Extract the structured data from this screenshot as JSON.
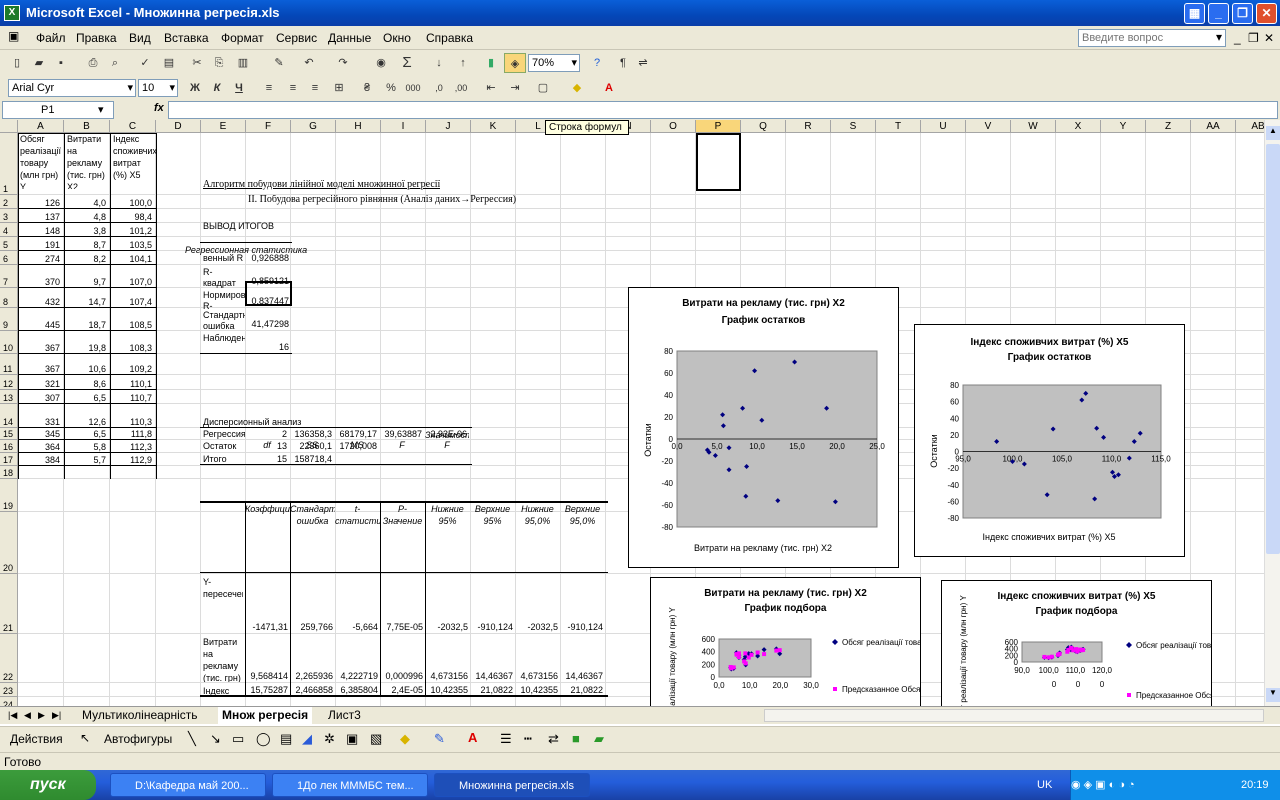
{
  "window": {
    "title": "Microsoft Excel - Множинна регресія.xls"
  },
  "menu": [
    "Файл",
    "Правка",
    "Вид",
    "Вставка",
    "Формат",
    "Сервис",
    "Данные",
    "Окно",
    "Справка"
  ],
  "help_placeholder": "Введите вопрос",
  "toolbar": {
    "zoom": "70%",
    "font": "Arial Cyr",
    "size": "10",
    "bold": "Ж",
    "italic": "К",
    "underline": "Ч",
    "sigma": "Σ"
  },
  "formula_bar": {
    "cell": "P1",
    "fx": "fx",
    "tooltip": "Строка формул"
  },
  "columns": [
    "A",
    "B",
    "C",
    "D",
    "E",
    "F",
    "G",
    "H",
    "I",
    "J",
    "K",
    "L",
    "M",
    "N",
    "O",
    "P",
    "Q",
    "R",
    "S",
    "T",
    "U",
    "V",
    "W",
    "X",
    "Y",
    "Z",
    "AA",
    "AB"
  ],
  "rows": [
    "1",
    "2",
    "3",
    "4",
    "5",
    "6",
    "7",
    "8",
    "9",
    "10",
    "11",
    "12",
    "13",
    "14",
    "15",
    "16",
    "17",
    "18",
    "19",
    "20",
    "21",
    "22",
    "23",
    "24"
  ],
  "headers": {
    "A": "Обсяг реалізації товару (млн грн) Y",
    "B": "Витрати на рекламу (тис. грн) X2",
    "C": "Індекс споживчих витрат (%) X5"
  },
  "data": [
    [
      "126",
      "4,0",
      "100,0"
    ],
    [
      "137",
      "4,8",
      "98,4"
    ],
    [
      "148",
      "3,8",
      "101,2"
    ],
    [
      "191",
      "8,7",
      "103,5"
    ],
    [
      "274",
      "8,2",
      "104,1"
    ],
    [
      "370",
      "9,7",
      "107,0"
    ],
    [
      "432",
      "14,7",
      "107,4"
    ],
    [
      "445",
      "18,7",
      "108,5"
    ],
    [
      "367",
      "19,8",
      "108,3"
    ],
    [
      "367",
      "10,6",
      "109,2"
    ],
    [
      "321",
      "8,6",
      "110,1"
    ],
    [
      "307",
      "6,5",
      "110,7"
    ],
    [
      "331",
      "12,6",
      "110,3"
    ],
    [
      "345",
      "6,5",
      "111,8"
    ],
    [
      "364",
      "5,8",
      "112,3"
    ],
    [
      "384",
      "5,7",
      "112,9"
    ]
  ],
  "algo_title": "Алгоритм побудови лінійної моделі множинної регресії",
  "algo_sub": "ІІ. Побудова регресійного рівняння (Аналіз даних→Регрессия)",
  "output_title": "ВЫВОД ИТОГОВ",
  "regstat_title": "Регрессионная статистика",
  "regstat": [
    [
      "венный R",
      "0,926888"
    ],
    [
      "R-квадрат",
      "0,859121"
    ],
    [
      "Нормированный R-",
      "0,837447"
    ],
    [
      "Стандартная ошибка",
      "41,47298"
    ],
    [
      "Наблюдения",
      "16"
    ]
  ],
  "anova_title": "Дисперсионный анализ",
  "anova_head": [
    "df",
    "SS",
    "MS",
    "F",
    "Значимость F"
  ],
  "anova": [
    [
      "Регрессия",
      "2",
      "136358,3",
      "68179,17",
      "39,63887",
      "2,93E-06"
    ],
    [
      "Остаток",
      "13",
      "22360,1",
      "1720,008",
      "",
      ""
    ],
    [
      "Итого",
      "15",
      "158718,4",
      "",
      "",
      ""
    ]
  ],
  "coef_head": [
    "Коэффициенты",
    "Стандартная ошибка",
    "t-статистика",
    "P-Значение",
    "Нижние 95%",
    "Верхние 95%",
    "Нижние 95,0%",
    "Верхние 95,0%"
  ],
  "coef": [
    [
      "Y-пересечение",
      "-1471,31",
      "259,766",
      "-5,664",
      "7,75E-05",
      "-2032,5",
      "-910,124",
      "-2032,5",
      "-910,124"
    ],
    [
      "Витрати на рекламу (тис. грн) X2",
      "9,568414",
      "2,265936",
      "4,222719",
      "0,000996",
      "4,673156",
      "14,46367",
      "4,673156",
      "14,46367"
    ],
    [
      "Індекс споживчих витрат",
      "15,75287",
      "2,466858",
      "6,385804",
      "2,4E-05",
      "10,42355",
      "21,0822",
      "10,42355",
      "21,0822"
    ]
  ],
  "charts": {
    "r1": {
      "title": "Витрати на рекламу (тис. грн) X2",
      "sub": "График остатков",
      "xlabel": "Витрати на рекламу (тис. грн) X2",
      "ylabel": "Остатки",
      "yticks": [
        "80",
        "60",
        "40",
        "20",
        "0",
        "-20",
        "-40",
        "-60",
        "-80"
      ],
      "xticks": [
        "0,0",
        "5,0",
        "10,0",
        "15,0",
        "20,0",
        "25,0"
      ]
    },
    "r2": {
      "title": "Індекс споживчих витрат (%) X5",
      "sub": "График остатков",
      "xlabel": "Індекс споживчих витрат (%) X5",
      "ylabel": "Остатки",
      "yticks": [
        "80",
        "60",
        "40",
        "20",
        "0",
        "-20",
        "-40",
        "-60",
        "-80"
      ],
      "xticks": [
        "95,0",
        "100,0",
        "105,0",
        "110,0",
        "115,0"
      ]
    },
    "f1": {
      "title": "Витрати на рекламу (тис. грн) X2",
      "sub": "График подбора",
      "ylabel": "Обсяг реалізації товару (млн грн) Y",
      "yticks": [
        "600",
        "400",
        "200",
        "0"
      ],
      "xticks": [
        "0,0",
        "10,0",
        "20,0",
        "30,0"
      ],
      "leg1": "Обсяг реалізації товару (млн грн) Y",
      "leg2": "Предсказанное Обсяг реалізації"
    },
    "f2": {
      "title": "Індекс споживчих витрат (%) X5",
      "sub": "График подбора",
      "ylabel": "Обсяг реалізації товару (млн грн) Y",
      "yticks": [
        "600",
        "400",
        "200",
        "0"
      ],
      "xticks": [
        "90,0",
        "100,0",
        "110,0",
        "120,0"
      ],
      "xticks2": [
        "0",
        "0",
        "0"
      ],
      "leg1": "Обсяг реалізації товару (млн грн) Y",
      "leg2": "Предсказанное Обсяг реалізації"
    }
  },
  "chart_data": [
    {
      "type": "scatter",
      "title": "Витрати на рекламу (тис. грн) X2 График остатков",
      "xlabel": "Витрати на рекламу (тис. грн) X2",
      "ylabel": "Остатки",
      "xlim": [
        0,
        25
      ],
      "ylim": [
        -80,
        80
      ],
      "x": [
        4.0,
        4.8,
        3.8,
        8.7,
        8.2,
        9.7,
        14.7,
        18.7,
        19.8,
        10.6,
        8.6,
        6.5,
        12.6,
        6.5,
        5.8,
        5.7
      ],
      "y": [
        -12,
        -15,
        -10,
        -25,
        28,
        62,
        70,
        28,
        -57,
        17,
        -52,
        -8,
        -56,
        -28,
        12,
        22
      ]
    },
    {
      "type": "scatter",
      "title": "Індекс споживчих витрат (%) X5 График остатков",
      "xlabel": "Індекс споживчих витрат (%) X5",
      "ylabel": "Остатки",
      "xlim": [
        95,
        115
      ],
      "ylim": [
        -80,
        80
      ],
      "x": [
        100.0,
        98.4,
        101.2,
        103.5,
        104.1,
        107.0,
        107.4,
        108.5,
        108.3,
        109.2,
        110.1,
        110.7,
        110.3,
        111.8,
        112.3,
        112.9
      ],
      "y": [
        -12,
        12,
        -15,
        -52,
        27,
        62,
        70,
        28,
        -57,
        17,
        -25,
        -28,
        -30,
        -8,
        12,
        22
      ]
    },
    {
      "type": "scatter",
      "title": "Витрати на рекламу (тис. грн) X2 График подбора",
      "xlim": [
        0,
        30
      ],
      "ylim": [
        0,
        600
      ],
      "series": [
        {
          "name": "Обсяг реалізації товару (млн грн) Y",
          "x": [
            4.0,
            4.8,
            3.8,
            8.7,
            8.2,
            9.7,
            14.7,
            18.7,
            19.8,
            10.6,
            8.6,
            6.5,
            12.6,
            6.5,
            5.8,
            5.7
          ],
          "y": [
            126,
            137,
            148,
            191,
            274,
            370,
            432,
            445,
            367,
            367,
            321,
            307,
            331,
            345,
            364,
            384
          ]
        },
        {
          "name": "Предсказанное Обсяг реалізації",
          "x": [
            4.0,
            4.8,
            3.8,
            8.7,
            8.2,
            9.7,
            14.7,
            18.7,
            19.8,
            10.6,
            8.6,
            6.5,
            12.6,
            6.5,
            5.8,
            5.7
          ],
          "y": [
            138,
            152,
            158,
            216,
            246,
            308,
            362,
            417,
            424,
            350,
            373,
            315,
            387,
            373,
            352,
            362
          ]
        }
      ]
    },
    {
      "type": "scatter",
      "title": "Індекс споживчих витрат (%) X5 График подбора",
      "xlim": [
        90,
        120
      ],
      "ylim": [
        0,
        600
      ],
      "series": [
        {
          "name": "Обсяг реалізації товару (млн грн) Y",
          "x": [
            100.0,
            98.4,
            101.2,
            103.5,
            104.1,
            107.0,
            107.4,
            108.5,
            108.3,
            109.2,
            110.1,
            110.7,
            110.3,
            111.8,
            112.3,
            112.9
          ],
          "y": [
            126,
            137,
            148,
            191,
            274,
            370,
            432,
            445,
            367,
            367,
            321,
            307,
            331,
            345,
            364,
            384
          ]
        },
        {
          "name": "Предсказанное Обсяг реалізації",
          "x": [
            100.0,
            98.4,
            101.2,
            103.5,
            104.1,
            107.0,
            107.4,
            108.5,
            108.3,
            109.2,
            110.1,
            110.7,
            110.3,
            111.8,
            112.3,
            112.9
          ],
          "y": [
            138,
            152,
            158,
            216,
            246,
            308,
            362,
            417,
            424,
            350,
            373,
            315,
            387,
            373,
            352,
            362
          ]
        }
      ]
    }
  ],
  "sheet_tabs": [
    "Мультиколінеарність",
    "Множ регресія",
    "Лист3"
  ],
  "drawbar": {
    "actions": "Действия",
    "autoshapes": "Автофигуры"
  },
  "status": "Готово",
  "taskbar": {
    "start": "пуск",
    "tasks": [
      "D:\\Кафедра май 200...",
      "1До лек МММБС тем...",
      "Множинна регресія.xls"
    ],
    "lang": "UK",
    "time": "20:19"
  },
  "colors": {
    "title": "#0a5fd8",
    "series1": "#000080",
    "series2": "#ff00ff",
    "plot": "#c0c0c0"
  }
}
